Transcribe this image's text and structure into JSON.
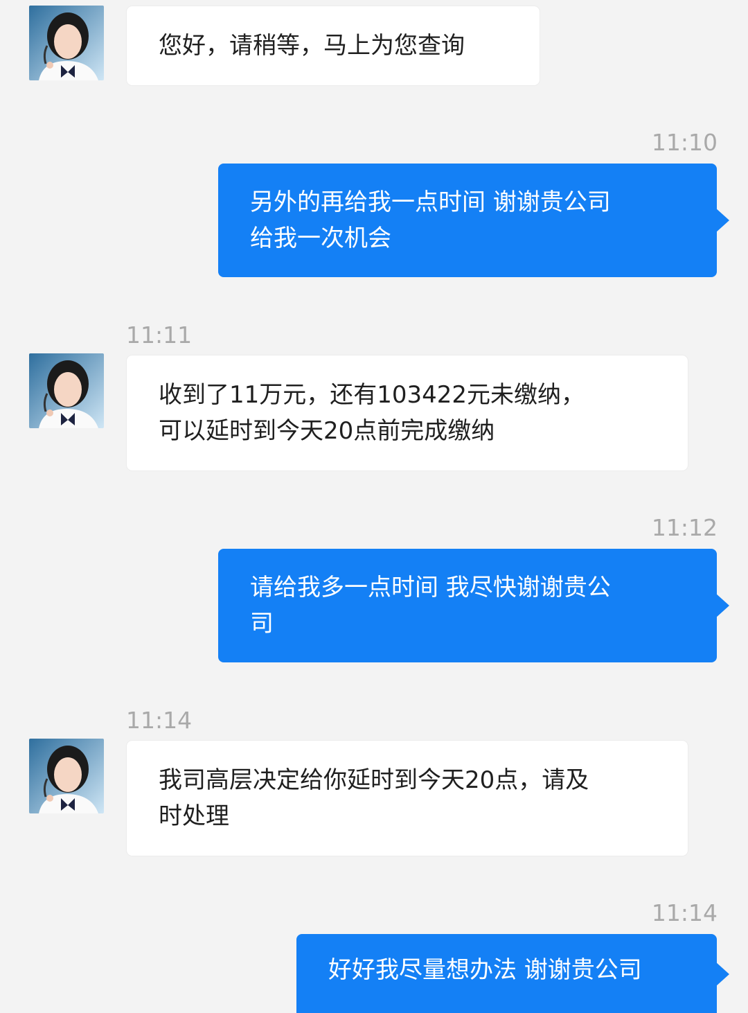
{
  "colors": {
    "background": "#f3f3f3",
    "incoming_bubble": "#ffffff",
    "outgoing_bubble": "#1480f5",
    "timestamp": "#a9a9a9"
  },
  "messages": [
    {
      "direction": "incoming",
      "avatar": "agent-avatar",
      "lines": [
        "您好，请稍等，马上为您查询"
      ]
    },
    {
      "timestamp": "11:10"
    },
    {
      "direction": "outgoing",
      "lines": [
        "另外的再给我一点时间 谢谢贵公司",
        "给我一次机会"
      ]
    },
    {
      "timestamp": "11:11"
    },
    {
      "direction": "incoming",
      "avatar": "agent-avatar",
      "lines": [
        "收到了11万元，还有103422元未缴纳，",
        "可以延时到今天20点前完成缴纳"
      ]
    },
    {
      "timestamp": "11:12"
    },
    {
      "direction": "outgoing",
      "lines": [
        "请给我多一点时间 我尽快谢谢贵公",
        "司"
      ]
    },
    {
      "timestamp": "11:14"
    },
    {
      "direction": "incoming",
      "avatar": "agent-avatar",
      "lines": [
        "我司高层决定给你延时到今天20点，请及",
        "时处理"
      ]
    },
    {
      "timestamp": "11:14"
    },
    {
      "direction": "outgoing",
      "lines": [
        "好好我尽量想办法 谢谢贵公司"
      ]
    }
  ]
}
